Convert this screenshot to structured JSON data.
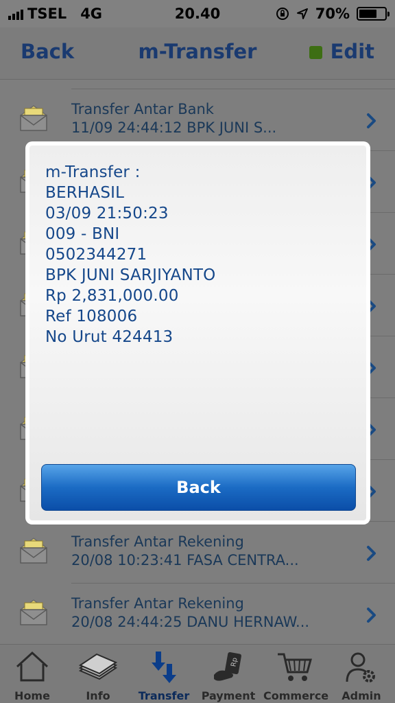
{
  "status_bar": {
    "carrier": "TSEL",
    "network": "4G",
    "time": "20.40",
    "battery": "70%",
    "battery_level": 0.7
  },
  "nav": {
    "back_label": "Back",
    "title": "m-Transfer",
    "edit_label": "Edit"
  },
  "list": {
    "items": [
      {
        "title": "Transfer Antar Bank",
        "detail": "11/09 24:44:12 BPK JUNI  S..."
      },
      {
        "title": "",
        "detail": ""
      },
      {
        "title": "",
        "detail": ""
      },
      {
        "title": "",
        "detail": ""
      },
      {
        "title": "",
        "detail": ""
      },
      {
        "title": "",
        "detail": ""
      },
      {
        "title": "",
        "detail": ""
      },
      {
        "title": "Transfer Antar Rekening",
        "detail": "20/08 10:23:41 FASA CENTRA..."
      },
      {
        "title": "Transfer Antar Rekening",
        "detail": "20/08 24:44:25 DANU HERNAW..."
      }
    ]
  },
  "modal": {
    "lines": [
      "m-Transfer :",
      "BERHASIL",
      "03/09 21:50:23",
      "009 - BNI",
      "0502344271",
      "BPK JUNI  SARJIYANTO",
      "Rp 2,831,000.00",
      "Ref 108006",
      "No Urut 424413"
    ],
    "button_label": "Back"
  },
  "tabbar": {
    "tabs": [
      {
        "label": "Home",
        "icon": "home-icon"
      },
      {
        "label": "Info",
        "icon": "info-icon"
      },
      {
        "label": "Transfer",
        "icon": "transfer-icon"
      },
      {
        "label": "Payment",
        "icon": "payment-icon"
      },
      {
        "label": "Commerce",
        "icon": "cart-icon"
      },
      {
        "label": "Admin",
        "icon": "admin-icon"
      }
    ],
    "active": "Transfer"
  },
  "colors": {
    "brand_text": "#15478a",
    "nav_text": "#1a3a70",
    "status_dot": "#3d6e13",
    "button_top": "#57a4e8",
    "button_bottom": "#0b4ea8"
  }
}
